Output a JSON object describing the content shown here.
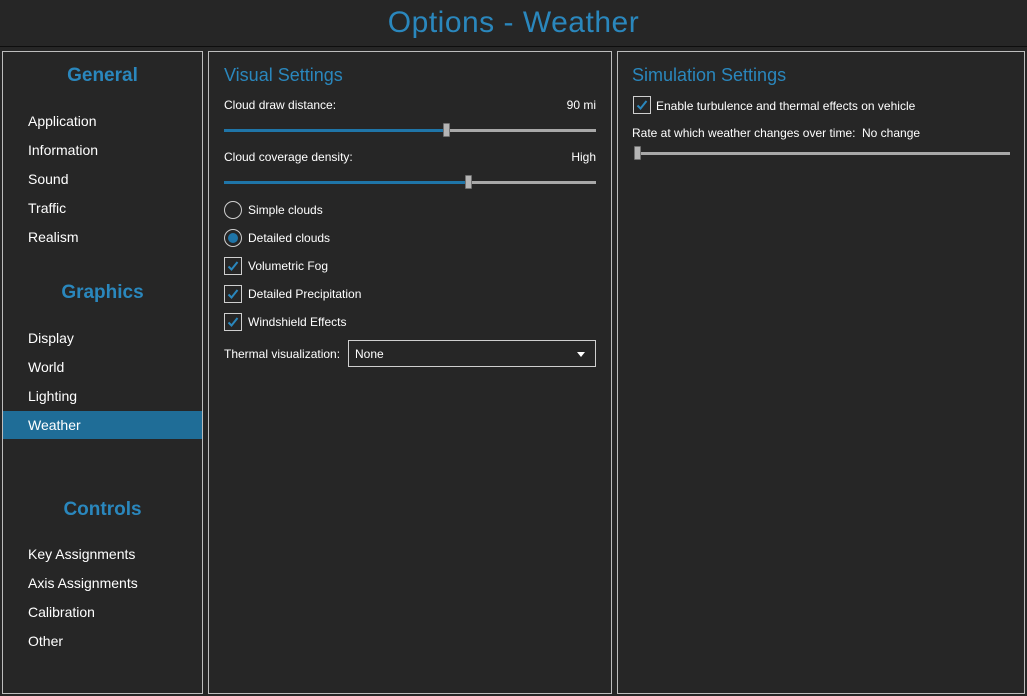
{
  "window": {
    "title": "Options - Weather"
  },
  "sidebar": {
    "sections": [
      {
        "heading": "General",
        "items": [
          "Application",
          "Information",
          "Sound",
          "Traffic",
          "Realism"
        ]
      },
      {
        "heading": "Graphics",
        "items": [
          "Display",
          "World",
          "Lighting",
          "Weather"
        ]
      },
      {
        "heading": "Controls",
        "items": [
          "Key Assignments",
          "Axis Assignments",
          "Calibration",
          "Other"
        ]
      }
    ],
    "active_item": "Weather"
  },
  "visual": {
    "title": "Visual Settings",
    "cloud_distance": {
      "label": "Cloud draw distance:",
      "value": "90 mi",
      "fraction": 0.6
    },
    "cloud_density": {
      "label": "Cloud coverage density:",
      "value": "High",
      "fraction": 0.66
    },
    "radios": [
      {
        "label": "Simple clouds",
        "selected": false
      },
      {
        "label": "Detailed clouds",
        "selected": true
      }
    ],
    "checkboxes": [
      {
        "label": "Volumetric Fog",
        "checked": true
      },
      {
        "label": "Detailed Precipitation",
        "checked": true
      },
      {
        "label": "Windshield Effects",
        "checked": true
      }
    ],
    "thermal": {
      "label": "Thermal visualization:",
      "value": "None"
    }
  },
  "simulation": {
    "title": "Simulation Settings",
    "turbulence": {
      "label": "Enable turbulence and thermal effects on vehicle",
      "checked": true
    },
    "rate": {
      "label": "Rate at which weather changes over time:",
      "value": "No change",
      "fraction": 0.0
    }
  },
  "colors": {
    "accent": "#2a87bd",
    "selection": "#1f6d97",
    "background": "#262626",
    "border": "#bdbdbd"
  }
}
